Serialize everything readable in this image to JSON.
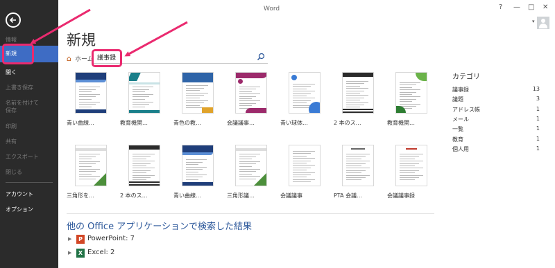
{
  "window": {
    "title": "Word",
    "help": "?",
    "minimize": "—",
    "maximize": "□",
    "close": "✕"
  },
  "sidebar": {
    "items": [
      {
        "label": "情報",
        "active": false
      },
      {
        "label": "新規",
        "active": true
      },
      {
        "label": "開く",
        "active": false
      },
      {
        "label": "上書き保存",
        "active": false
      },
      {
        "label": "名前を付けて",
        "active": false
      },
      {
        "label": "保存",
        "active": false
      },
      {
        "label": "印刷",
        "active": false
      },
      {
        "label": "共有",
        "active": false
      },
      {
        "label": "エクスポート",
        "active": false
      },
      {
        "label": "閉じる",
        "active": false
      },
      {
        "label": "アカウント",
        "active": false
      },
      {
        "label": "オプション",
        "active": false
      }
    ]
  },
  "main": {
    "title": "新規",
    "breadcrumb_home": "ホーム",
    "search": {
      "value": "議事録"
    }
  },
  "templates": [
    {
      "label": "青い曲線…",
      "theme": "navy-curve"
    },
    {
      "label": "教育機関…",
      "theme": "teal-stripe"
    },
    {
      "label": "青色の教…",
      "theme": "blue-block"
    },
    {
      "label": "会議議事…",
      "theme": "magenta-wave"
    },
    {
      "label": "青い球体…",
      "theme": "blue-orb"
    },
    {
      "label": "2 本のス…",
      "theme": "dark-stripes"
    },
    {
      "label": "教育機関…",
      "theme": "green-leaf"
    },
    {
      "label": "三角形を…",
      "theme": "green-triangle"
    },
    {
      "label": "2 本のス…",
      "theme": "dark-stripes"
    },
    {
      "label": "青い曲線…",
      "theme": "navy-curve"
    },
    {
      "label": "三角形議…",
      "theme": "green-triangle"
    },
    {
      "label": "会議議事",
      "theme": "plain"
    },
    {
      "label": "PTA 会議…",
      "theme": "plain-table"
    },
    {
      "label": "会議議事録",
      "theme": "plain-form"
    }
  ],
  "categories": {
    "title": "カテゴリ",
    "items": [
      {
        "name": "議事録",
        "count": "13"
      },
      {
        "name": "議題",
        "count": "3"
      },
      {
        "name": "アドレス帳",
        "count": "1"
      },
      {
        "name": "メール",
        "count": "1"
      },
      {
        "name": "一覧",
        "count": "1"
      },
      {
        "name": "教育",
        "count": "1"
      },
      {
        "name": "個人用",
        "count": "1"
      }
    ]
  },
  "other_apps": {
    "title": "他の Office アプリケーションで検索した結果",
    "apps": [
      {
        "name": "PowerPoint:",
        "count": "7",
        "logo": "P",
        "color": "#d24726"
      },
      {
        "name": "Excel:",
        "count": "2",
        "logo": "X",
        "color": "#217346"
      }
    ]
  },
  "colors": {
    "sidebar": "#2b2b2b",
    "accent": "#3e6cc4",
    "annotation": "#ea2a6f",
    "link": "#2b579a"
  }
}
